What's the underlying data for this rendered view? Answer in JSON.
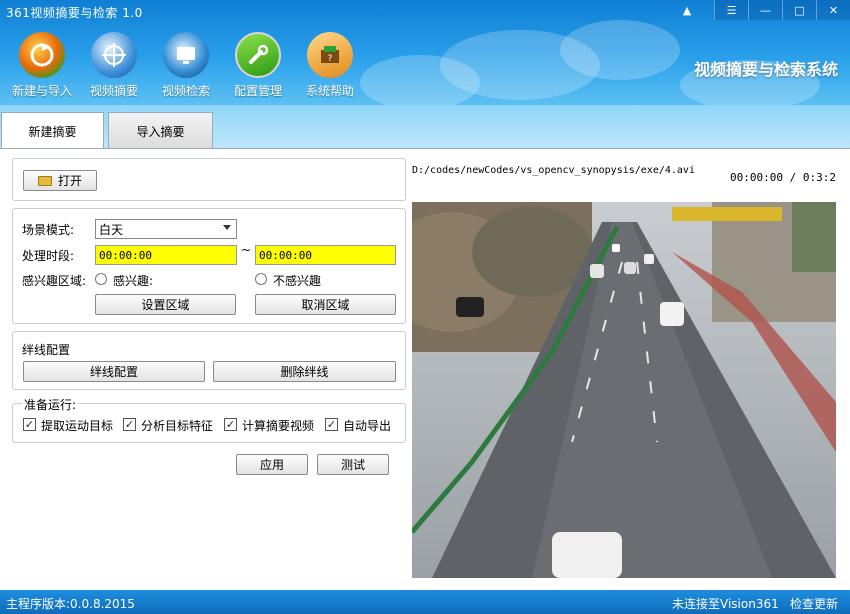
{
  "window": {
    "title": "361视频摘要与检索 1.0",
    "system_name": "视频摘要与检索系统"
  },
  "toolbar": [
    {
      "label": "新建与导入",
      "icon": "new-import-icon"
    },
    {
      "label": "视频摘要",
      "icon": "video-summary-icon"
    },
    {
      "label": "视频检索",
      "icon": "video-search-icon"
    },
    {
      "label": "配置管理",
      "icon": "config-icon"
    },
    {
      "label": "系统帮助",
      "icon": "help-icon"
    }
  ],
  "tabs": {
    "new_summary": "新建摘要",
    "import_summary": "导入摘要"
  },
  "open_button": "打开",
  "scene": {
    "label": "场景模式:",
    "selected": "白天"
  },
  "time_range": {
    "label": "处理时段:",
    "start": "00:00:00",
    "separator": "~",
    "end": "00:00:00"
  },
  "roi": {
    "label": "感兴趣区域:",
    "interest": "感兴趣:",
    "not_interest": "不感兴趣",
    "set_button": "设置区域",
    "cancel_button": "取消区域"
  },
  "tripwire": {
    "label": "绊线配置",
    "config_button": "绊线配置",
    "delete_button": "删除绊线"
  },
  "prepare": {
    "label": "准备运行:",
    "checks": [
      {
        "label": "提取运动目标",
        "checked": true
      },
      {
        "label": "分析目标特征",
        "checked": true
      },
      {
        "label": "计算摘要视频",
        "checked": true
      },
      {
        "label": "自动导出",
        "checked": true
      }
    ]
  },
  "actions": {
    "apply": "应用",
    "test": "测试"
  },
  "video": {
    "path": "D:/codes/newCodes/vs_opencv_synopysis/exe/4.avi",
    "time": "00:00:00 / 0:3:2"
  },
  "status": {
    "version": "主程序版本:0.0.8.2015",
    "connection": "未连接至Vision361",
    "update": "检查更新"
  },
  "colors": {
    "header": "#1a8fe0",
    "time_input_bg": "#ffff00",
    "status_bar": "#0d6cbb"
  }
}
